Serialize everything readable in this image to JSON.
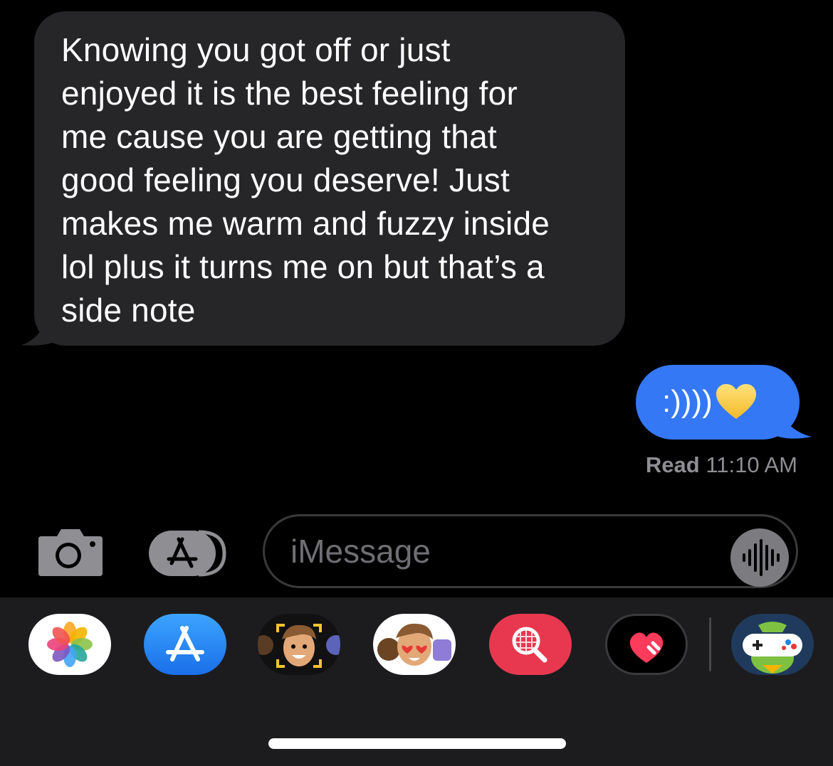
{
  "conversation": {
    "received_message": "Knowing you got off or just\nenjoyed it is the best feeling for\nme cause you are getting that\ngood feeling you deserve! Just\nmakes me warm and fuzzy inside\nlol plus it turns me on but that’s a\nside note",
    "sent_message": ":))))",
    "sent_emoji": "yellow-heart-icon",
    "read_label": "Read",
    "read_time": "11:10 AM"
  },
  "input_bar": {
    "placeholder": "iMessage",
    "camera_icon": "camera-icon",
    "apps_icon": "app-store-icon",
    "audio_icon": "audio-waveform-icon"
  },
  "app_drawer": {
    "apps": [
      {
        "name": "photos-app-icon"
      },
      {
        "name": "app-store-app-icon"
      },
      {
        "name": "memoji-app-icon"
      },
      {
        "name": "memoji-stickers-app-icon"
      },
      {
        "name": "image-search-app-icon"
      },
      {
        "name": "digital-touch-app-icon"
      },
      {
        "name": "game-app-icon"
      }
    ]
  },
  "colors": {
    "background": "#000000",
    "received_bubble": "#262628",
    "sent_bubble": "#3478f6",
    "secondary_text": "#8e8e93",
    "drawer": "#1c1c1e"
  }
}
